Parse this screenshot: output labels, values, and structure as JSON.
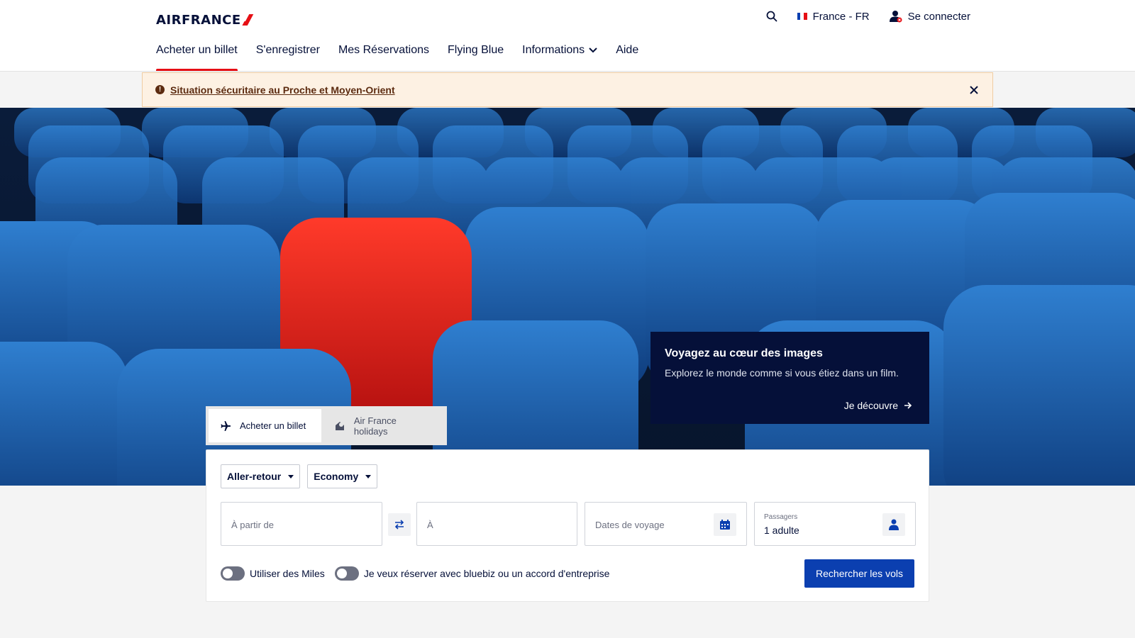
{
  "header": {
    "logo_text": "AIRFRANCE",
    "locale": "France - FR",
    "login": "Se connecter",
    "nav": [
      {
        "label": "Acheter un billet",
        "active": true
      },
      {
        "label": "S'enregistrer"
      },
      {
        "label": "Mes Réservations"
      },
      {
        "label": "Flying Blue"
      },
      {
        "label": "Informations",
        "has_dropdown": true
      },
      {
        "label": "Aide"
      }
    ]
  },
  "alert": {
    "text": "Situation sécuritaire au Proche et Moyen-Orient"
  },
  "hero": {
    "image_subject": "rows of blue cinema seats with one red seat",
    "promo": {
      "title": "Voyagez au cœur des images",
      "text": "Explorez le monde comme si vous étiez dans un film.",
      "cta": "Je découvre"
    }
  },
  "booking": {
    "tabs": [
      {
        "label": "Acheter un billet",
        "icon": "plane-icon",
        "active": true
      },
      {
        "label": "Air France holidays",
        "icon": "holidays-icon"
      }
    ],
    "trip_type": "Aller-retour",
    "cabin": "Economy",
    "from_placeholder": "À partir de",
    "to_placeholder": "À",
    "dates_placeholder": "Dates de voyage",
    "passengers_label": "Passagers",
    "passengers_value": "1 adulte",
    "miles_toggle": "Utiliser des Miles",
    "bluebiz_toggle": "Je veux réserver avec bluebiz ou un accord d'entreprise",
    "search_button": "Rechercher les vols"
  },
  "colors": {
    "brand_navy": "#051039",
    "brand_red": "#e60f15",
    "button_blue": "#0b3fb0",
    "alert_bg": "#fdf1e3"
  }
}
